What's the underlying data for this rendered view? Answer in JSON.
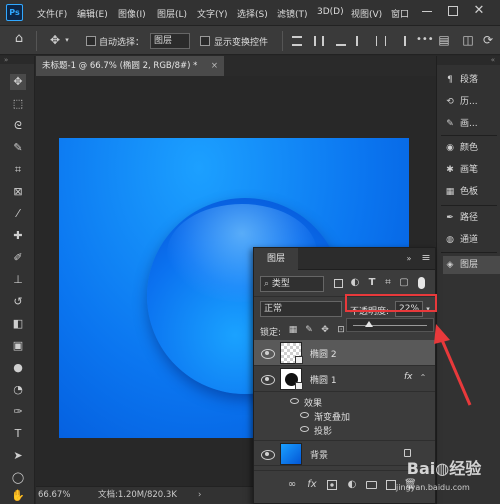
{
  "menubar": {
    "app_icon": "Ps",
    "items": [
      "文件(F)",
      "编辑(E)",
      "图像(I)",
      "图层(L)",
      "文字(Y)",
      "选择(S)",
      "滤镜(T)",
      "3D(D)",
      "视图(V)",
      "窗口"
    ]
  },
  "options": {
    "auto_select_label": "自动选择：",
    "auto_select_value": "图层",
    "show_transform_label": "显示变换控件"
  },
  "document": {
    "tab_title": "未标题-1 @ 66.7% (椭圆 2, RGB/8#) *",
    "close_icon": "×"
  },
  "status": {
    "zoom": "66.67%",
    "doc_info": "文档:1.20M/820.3K"
  },
  "right_panels": [
    {
      "icon": "paragraph-icon",
      "glyph": "¶",
      "label": "段落"
    },
    {
      "icon": "history-icon",
      "glyph": "⟲",
      "label": "历..."
    },
    {
      "icon": "brush-icon",
      "glyph": "✎",
      "label": "画..."
    },
    {
      "icon": "color-icon",
      "glyph": "◉",
      "label": "颜色"
    },
    {
      "icon": "brushes-icon",
      "glyph": "✱",
      "label": "画笔"
    },
    {
      "icon": "swatches-icon",
      "glyph": "▦",
      "label": "色板"
    },
    {
      "icon": "paths-icon",
      "glyph": "✒",
      "label": "路径"
    },
    {
      "icon": "channels-icon",
      "glyph": "◍",
      "label": "通道"
    },
    {
      "icon": "layers-icon",
      "glyph": "◈",
      "label": "图层"
    }
  ],
  "layers_panel": {
    "title": "图层",
    "filter_label": "类型",
    "blend_mode": "正常",
    "opacity_label": "不透明度:",
    "opacity_value": "22%",
    "opacity_fraction": 0.22,
    "lock_label": "锁定:",
    "fx_label": "fx",
    "layers": [
      {
        "name": "椭圆 2",
        "selected": true
      },
      {
        "name": "椭圆 1",
        "has_fx": true
      },
      {
        "name": "效果",
        "sub": true
      },
      {
        "name": "渐变叠加",
        "sub": true
      },
      {
        "name": "投影",
        "sub": true
      },
      {
        "name": "背景",
        "locked": true
      }
    ],
    "bottom_icons": [
      "link-icon",
      "fx-icon",
      "mask-icon",
      "adjustment-icon",
      "group-icon",
      "new-layer-icon",
      "trash-icon"
    ]
  },
  "colors": {
    "accent": "#31a8ff",
    "annotation": "#e8393b",
    "canvas_blue": "#0b76f0",
    "selected_row": "#595959"
  },
  "watermark": "jingyan.baidu.com"
}
